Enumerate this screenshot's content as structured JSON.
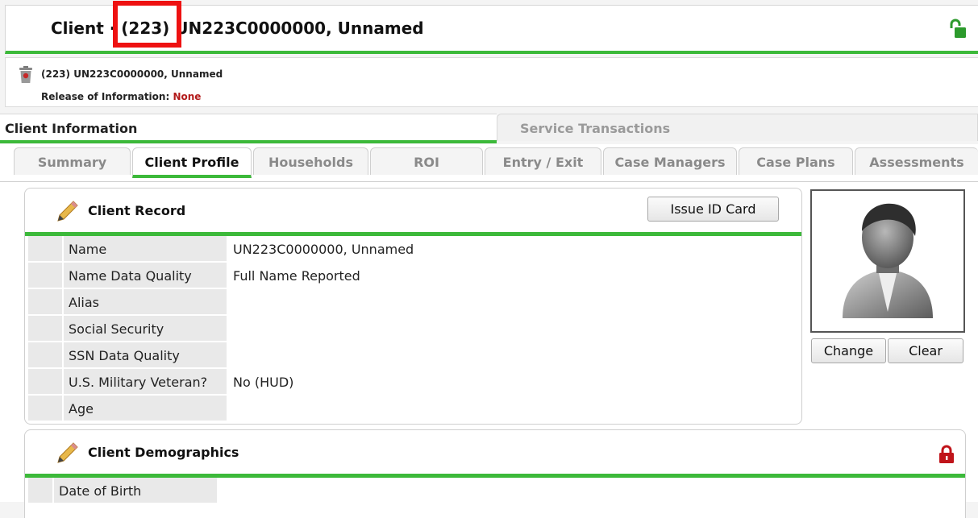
{
  "header": {
    "title_prefix": "Client · ",
    "title_id": "(223)",
    "title_rest": " UN223C0000000, Unnamed"
  },
  "infobar": {
    "client_line": "(223) UN223C0000000, Unnamed",
    "roi_label": "Release of Information: ",
    "roi_value": "None"
  },
  "main_tabs": [
    {
      "label": "Client Information"
    },
    {
      "label": "Service Transactions"
    }
  ],
  "sub_tabs": [
    {
      "label": "Summary"
    },
    {
      "label": "Client Profile"
    },
    {
      "label": "Households"
    },
    {
      "label": "ROI"
    },
    {
      "label": "Entry / Exit"
    },
    {
      "label": "Case Managers"
    },
    {
      "label": "Case Plans"
    },
    {
      "label": "Assessments"
    }
  ],
  "client_record": {
    "title": "Client Record",
    "issue_button": "Issue ID Card",
    "rows": [
      {
        "label": "Name",
        "value": "UN223C0000000, Unnamed"
      },
      {
        "label": "Name Data Quality",
        "value": "Full Name Reported"
      },
      {
        "label": "Alias",
        "value": ""
      },
      {
        "label": "Social Security",
        "value": ""
      },
      {
        "label": "SSN Data Quality",
        "value": ""
      },
      {
        "label": "U.S. Military Veteran?",
        "value": "No (HUD)"
      },
      {
        "label": "Age",
        "value": ""
      }
    ]
  },
  "photo": {
    "change_label": "Change",
    "clear_label": "Clear"
  },
  "client_demographics": {
    "title": "Client Demographics",
    "rows": [
      {
        "label": "Date of Birth",
        "value": ""
      }
    ]
  },
  "colors": {
    "accent_green": "#3cb93a",
    "highlight_red": "#ee1111",
    "roi_red": "#b31b1b"
  }
}
